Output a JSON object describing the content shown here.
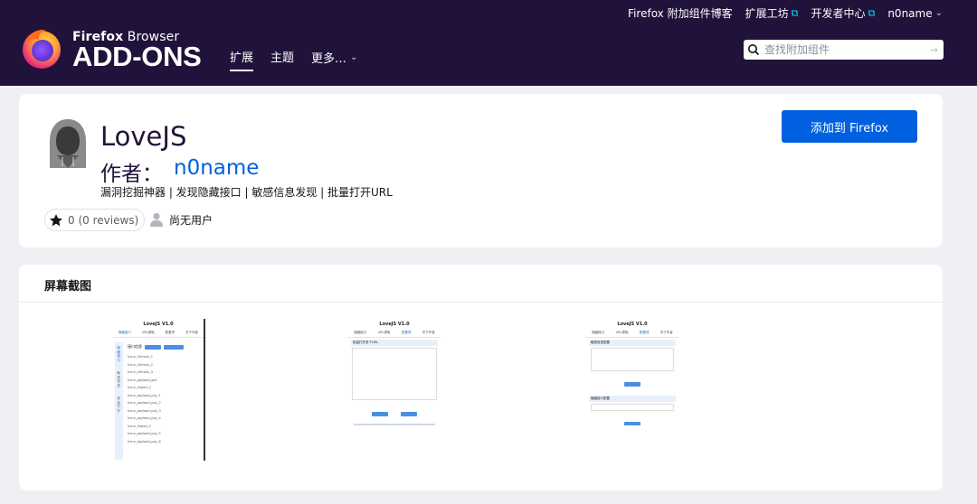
{
  "header": {
    "brand_small_bold": "Firefox",
    "brand_small": "Browser",
    "brand_big": "ADD-ONS",
    "top_links": [
      "Firefox 附加组件博客",
      "扩展工坊",
      "开发者中心",
      "n0name"
    ],
    "nav": [
      "扩展",
      "主题",
      "更多…"
    ],
    "search_placeholder": "查找附加组件"
  },
  "addon": {
    "name": "LoveJS",
    "author_label": "作者：",
    "author": "n0name",
    "summary": "漏洞挖掘神器 | 发现隐藏接口 | 敏感信息发现 | 批量打开URL",
    "rating_text": "0 (0 reviews)",
    "users_text": "尚无用户",
    "install_button": "添加到 Firefox"
  },
  "screenshots": {
    "title": "屏幕截图",
    "thumb1": {
      "title": "LoveJS V1.0",
      "tabs": [
        "隐藏接口",
        "URL提取",
        "配置项",
        "关于作者"
      ],
      "sidebar": [
        "隐藏接口",
        "敏感信息",
        "批量打开"
      ],
      "bar": "接口信息",
      "list": [
        "hunn_V0main_1",
        "hunn_V0main_2",
        "hunn_V0main_3",
        "hunn_payload_get",
        "hunn_import_1",
        "hunn_payload_pay_1",
        "hunn_payload_pay_2",
        "hunn_payload_pay_3",
        "hunn_payload_pay_4",
        "hunn_import_2",
        "hunn_payload_pay_5",
        "hunn_payload_pay_6"
      ]
    },
    "thumb2": {
      "title": "LoveJS V1.0",
      "tabs": [
        "隐藏接口",
        "URL提取",
        "配置项",
        "关于作者"
      ],
      "bar": "批量打开多个URL"
    },
    "thumb3": {
      "title": "LoveJS V1.0",
      "tabs": [
        "隐藏接口",
        "URL提取",
        "配置项",
        "关于作者"
      ],
      "bar1": "敏感信息配置",
      "bar2": "隐藏接口配置"
    }
  }
}
